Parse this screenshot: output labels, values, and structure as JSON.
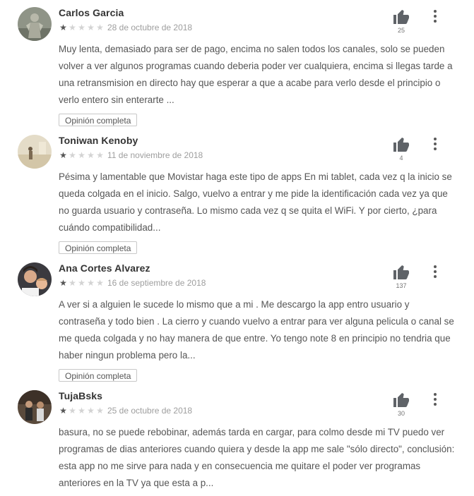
{
  "full_review_label": "Opinión completa",
  "reviews": [
    {
      "author": "Carlos Garcia",
      "rating": 1,
      "date": "28 de octubre de 2018",
      "likes": "25",
      "text": "Muy lenta, demasiado para ser de pago, encima no salen todos los canales, solo se pueden volver a ver algunos programas cuando deberia poder ver cualquiera, encima si llegas tarde a una retransmision en directo hay que esperar a que a acabe para verlo desde el principio o verlo entero sin enterarte ..."
    },
    {
      "author": "Toniwan Kenoby",
      "rating": 1,
      "date": "11 de noviembre de 2018",
      "likes": "4",
      "text": "Pésima y lamentable que Movistar haga este tipo de apps En mi tablet, cada vez q la inicio se queda colgada en el inicio. Salgo, vuelvo a entrar y me pide la identificación cada vez ya que no guarda usuario y contraseña. Lo mismo cada vez q se quita el WiFi. Y por cierto, ¿para cuándo compatibilidad..."
    },
    {
      "author": "Ana Cortes Alvarez",
      "rating": 1,
      "date": "16 de septiembre de 2018",
      "likes": "137",
      "text": "A ver si a alguien le sucede lo mismo que a mi . Me descargo la app entro usuario y contraseña y todo bien . La cierro y cuando vuelvo a entrar para ver alguna pelicula o canal se me queda colgada y no hay manera de que entre. Yo tengo note 8 en principio no tendria que haber ningun problema pero la..."
    },
    {
      "author": "TujaBsks",
      "rating": 1,
      "date": "25 de octubre de 2018",
      "likes": "30",
      "text": "basura, no se puede rebobinar, además tarda en cargar, para colmo desde mi TV puedo ver programas de dias anteriores cuando quiera y desde la app me sale \"sólo directo\", conclusión: esta app no me sirve para nada y en consecuencia me quitare el poder ver programas anteriores en la TV ya que esta a p..."
    }
  ]
}
